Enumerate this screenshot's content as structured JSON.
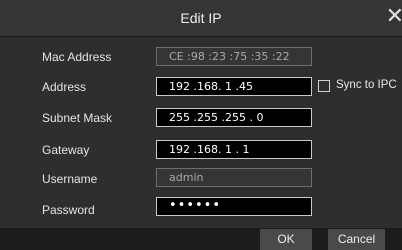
{
  "dialog": {
    "title": "Edit IP",
    "close_glyph": "✕"
  },
  "fields": {
    "mac_address": {
      "label": "Mac Address",
      "value": "CE :98 :23 :75 :35 :22"
    },
    "address": {
      "label": "Address",
      "value": "192 .168.  1  .45"
    },
    "subnet_mask": {
      "label": "Subnet Mask",
      "value": "255 .255 .255 .  0"
    },
    "gateway": {
      "label": "Gateway",
      "value": "192 .168.  1  .  1"
    },
    "username": {
      "label": "Username",
      "value": "admin"
    },
    "password": {
      "label": "Password",
      "value": "••••••"
    }
  },
  "sync": {
    "label": "Sync to IPC",
    "checked": false
  },
  "buttons": {
    "ok": "OK",
    "cancel": "Cancel"
  },
  "icons": {
    "close": "close-icon"
  }
}
